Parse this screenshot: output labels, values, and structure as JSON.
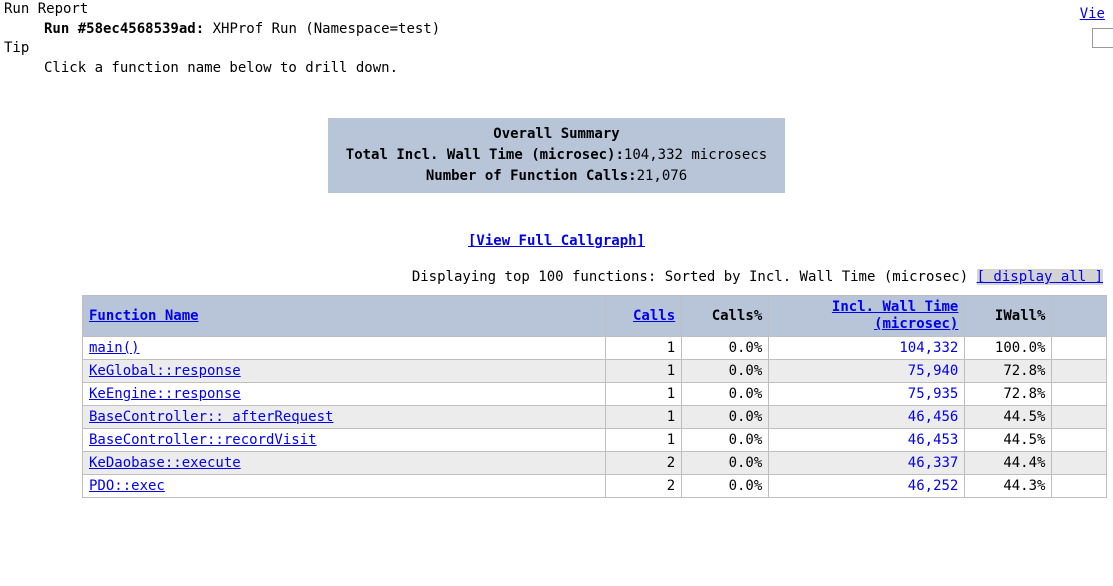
{
  "topLink": "Vie",
  "header": {
    "runReport": "Run Report",
    "runPrefix": "Run #58ec4568539ad:",
    "runType": " XHProf Run (Namespace=test)",
    "tip": "Tip",
    "tipText": "Click a function name below to drill down."
  },
  "summary": {
    "title": "Overall Summary",
    "row1Label": "Total Incl. Wall Time (microsec):",
    "row1Value": " 104,332 microsecs",
    "row2Label": "Number of Function Calls:",
    "row2Value": " 21,076"
  },
  "callgraphLink": "[View Full Callgraph]",
  "displayLine": {
    "text": "Displaying top 100 functions: Sorted by Incl. Wall Time (microsec) ",
    "link": "[ display all ]"
  },
  "table": {
    "headers": {
      "fn": "Function Name",
      "calls": "Calls",
      "callsPct": "Calls%",
      "wall": "Incl. Wall Time (microsec)",
      "iwall": "IWall%"
    },
    "rows": [
      {
        "alt": false,
        "fn": "main()",
        "calls": "1",
        "callsPct": "0.0%",
        "wall": "104,332",
        "iwall": "100.0%"
      },
      {
        "alt": true,
        "fn": "KeGlobal::response",
        "calls": "1",
        "callsPct": "0.0%",
        "wall": "75,940",
        "iwall": "72.8%"
      },
      {
        "alt": false,
        "fn": "KeEngine::response",
        "calls": "1",
        "callsPct": "0.0%",
        "wall": "75,935",
        "iwall": "72.8%"
      },
      {
        "alt": true,
        "fn": "BaseController:: afterRequest",
        "calls": "1",
        "callsPct": "0.0%",
        "wall": "46,456",
        "iwall": "44.5%"
      },
      {
        "alt": false,
        "fn": "BaseController::recordVisit",
        "calls": "1",
        "callsPct": "0.0%",
        "wall": "46,453",
        "iwall": "44.5%"
      },
      {
        "alt": true,
        "fn": "KeDaobase::execute",
        "calls": "2",
        "callsPct": "0.0%",
        "wall": "46,337",
        "iwall": "44.4%"
      },
      {
        "alt": false,
        "fn": "PDO::exec",
        "calls": "2",
        "callsPct": "0.0%",
        "wall": "46,252",
        "iwall": "44.3%"
      }
    ]
  }
}
